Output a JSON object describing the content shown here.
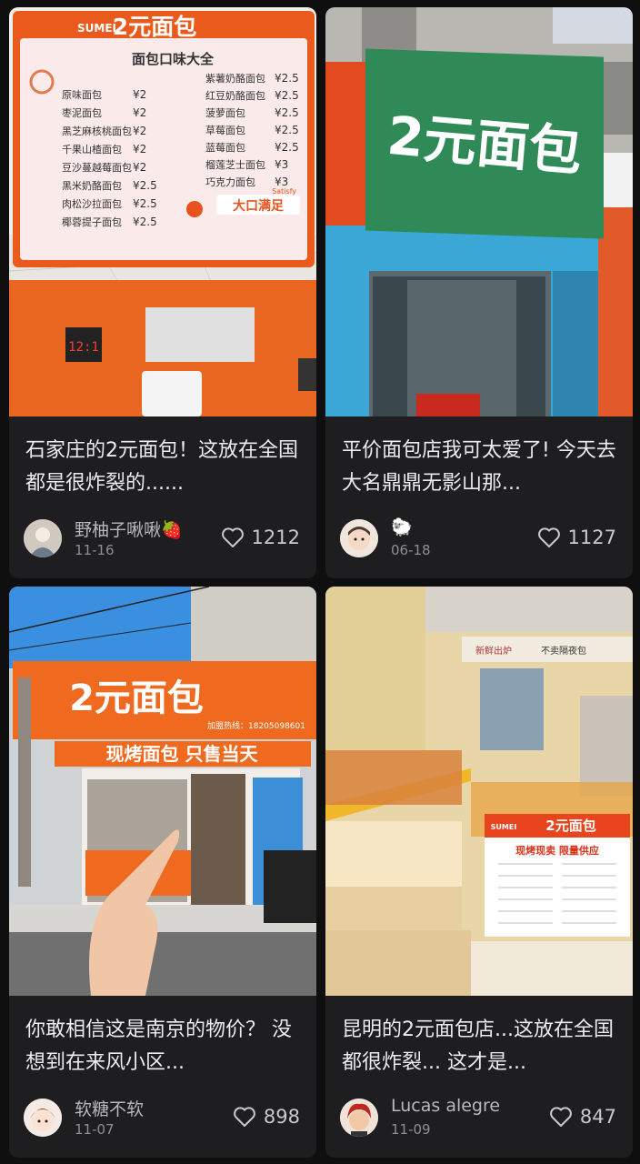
{
  "cards": [
    {
      "title": "石家庄的2元面包！这放在全国都是很炸裂的......",
      "author": "野柚子啾啾🍓",
      "date": "11-16",
      "likes": "1212",
      "image": {
        "brand": "SUMEI",
        "sign_title": "2元面包",
        "menu_heading": "面包口味大全",
        "slogan": "大口满足",
        "slogan_en": "Satisfy",
        "menu_left": [
          {
            "name": "原味面包",
            "price": "¥2"
          },
          {
            "name": "枣泥面包",
            "price": "¥2"
          },
          {
            "name": "黑芝麻核桃面包",
            "price": "¥2"
          },
          {
            "name": "千果山楂面包",
            "price": "¥2"
          },
          {
            "name": "豆沙蔓越莓面包",
            "price": "¥2"
          },
          {
            "name": "黑米奶酪面包",
            "price": "¥2.5"
          },
          {
            "name": "肉松沙拉面包",
            "price": "¥2.5"
          },
          {
            "name": "椰蓉提子面包",
            "price": "¥2.5"
          }
        ],
        "menu_right": [
          {
            "name": "紫薯奶酪面包",
            "price": "¥2.5"
          },
          {
            "name": "红豆奶酪面包",
            "price": "¥2.5"
          },
          {
            "name": "菠萝面包",
            "price": "¥2.5"
          },
          {
            "name": "草莓面包",
            "price": "¥2.5"
          },
          {
            "name": "蓝莓面包",
            "price": "¥2.5"
          },
          {
            "name": "榴莲芝士面包",
            "price": "¥3"
          },
          {
            "name": "巧克力面包",
            "price": "¥3"
          }
        ]
      }
    },
    {
      "title": "平价面包店我可太爱了! 今天去大名鼎鼎无影山那...",
      "author": "🐑",
      "date": "06-18",
      "likes": "1127",
      "image": {
        "sign_title": "2元面包"
      }
    },
    {
      "title": "你敢相信这是南京的物价？ 没想到在来风小区...",
      "author": "软糖不软",
      "date": "11-07",
      "likes": "898",
      "image": {
        "sign_title": "2元面包",
        "hotline": "加盟热线：18205098601",
        "banner": "现烤面包 只售当天"
      }
    },
    {
      "title": "昆明的2元面包店...这放在全国都很炸裂... 这才是...",
      "author": "Lucas alegre",
      "date": "11-09",
      "likes": "847",
      "image": {
        "brand": "SUMEI",
        "sign_title": "2元面包",
        "tagline": "现烤现卖  限量供应",
        "wall_left": "新鲜出炉",
        "wall_right": "不卖隔夜包"
      }
    }
  ],
  "icons": {
    "like": "heart-outline-icon"
  }
}
